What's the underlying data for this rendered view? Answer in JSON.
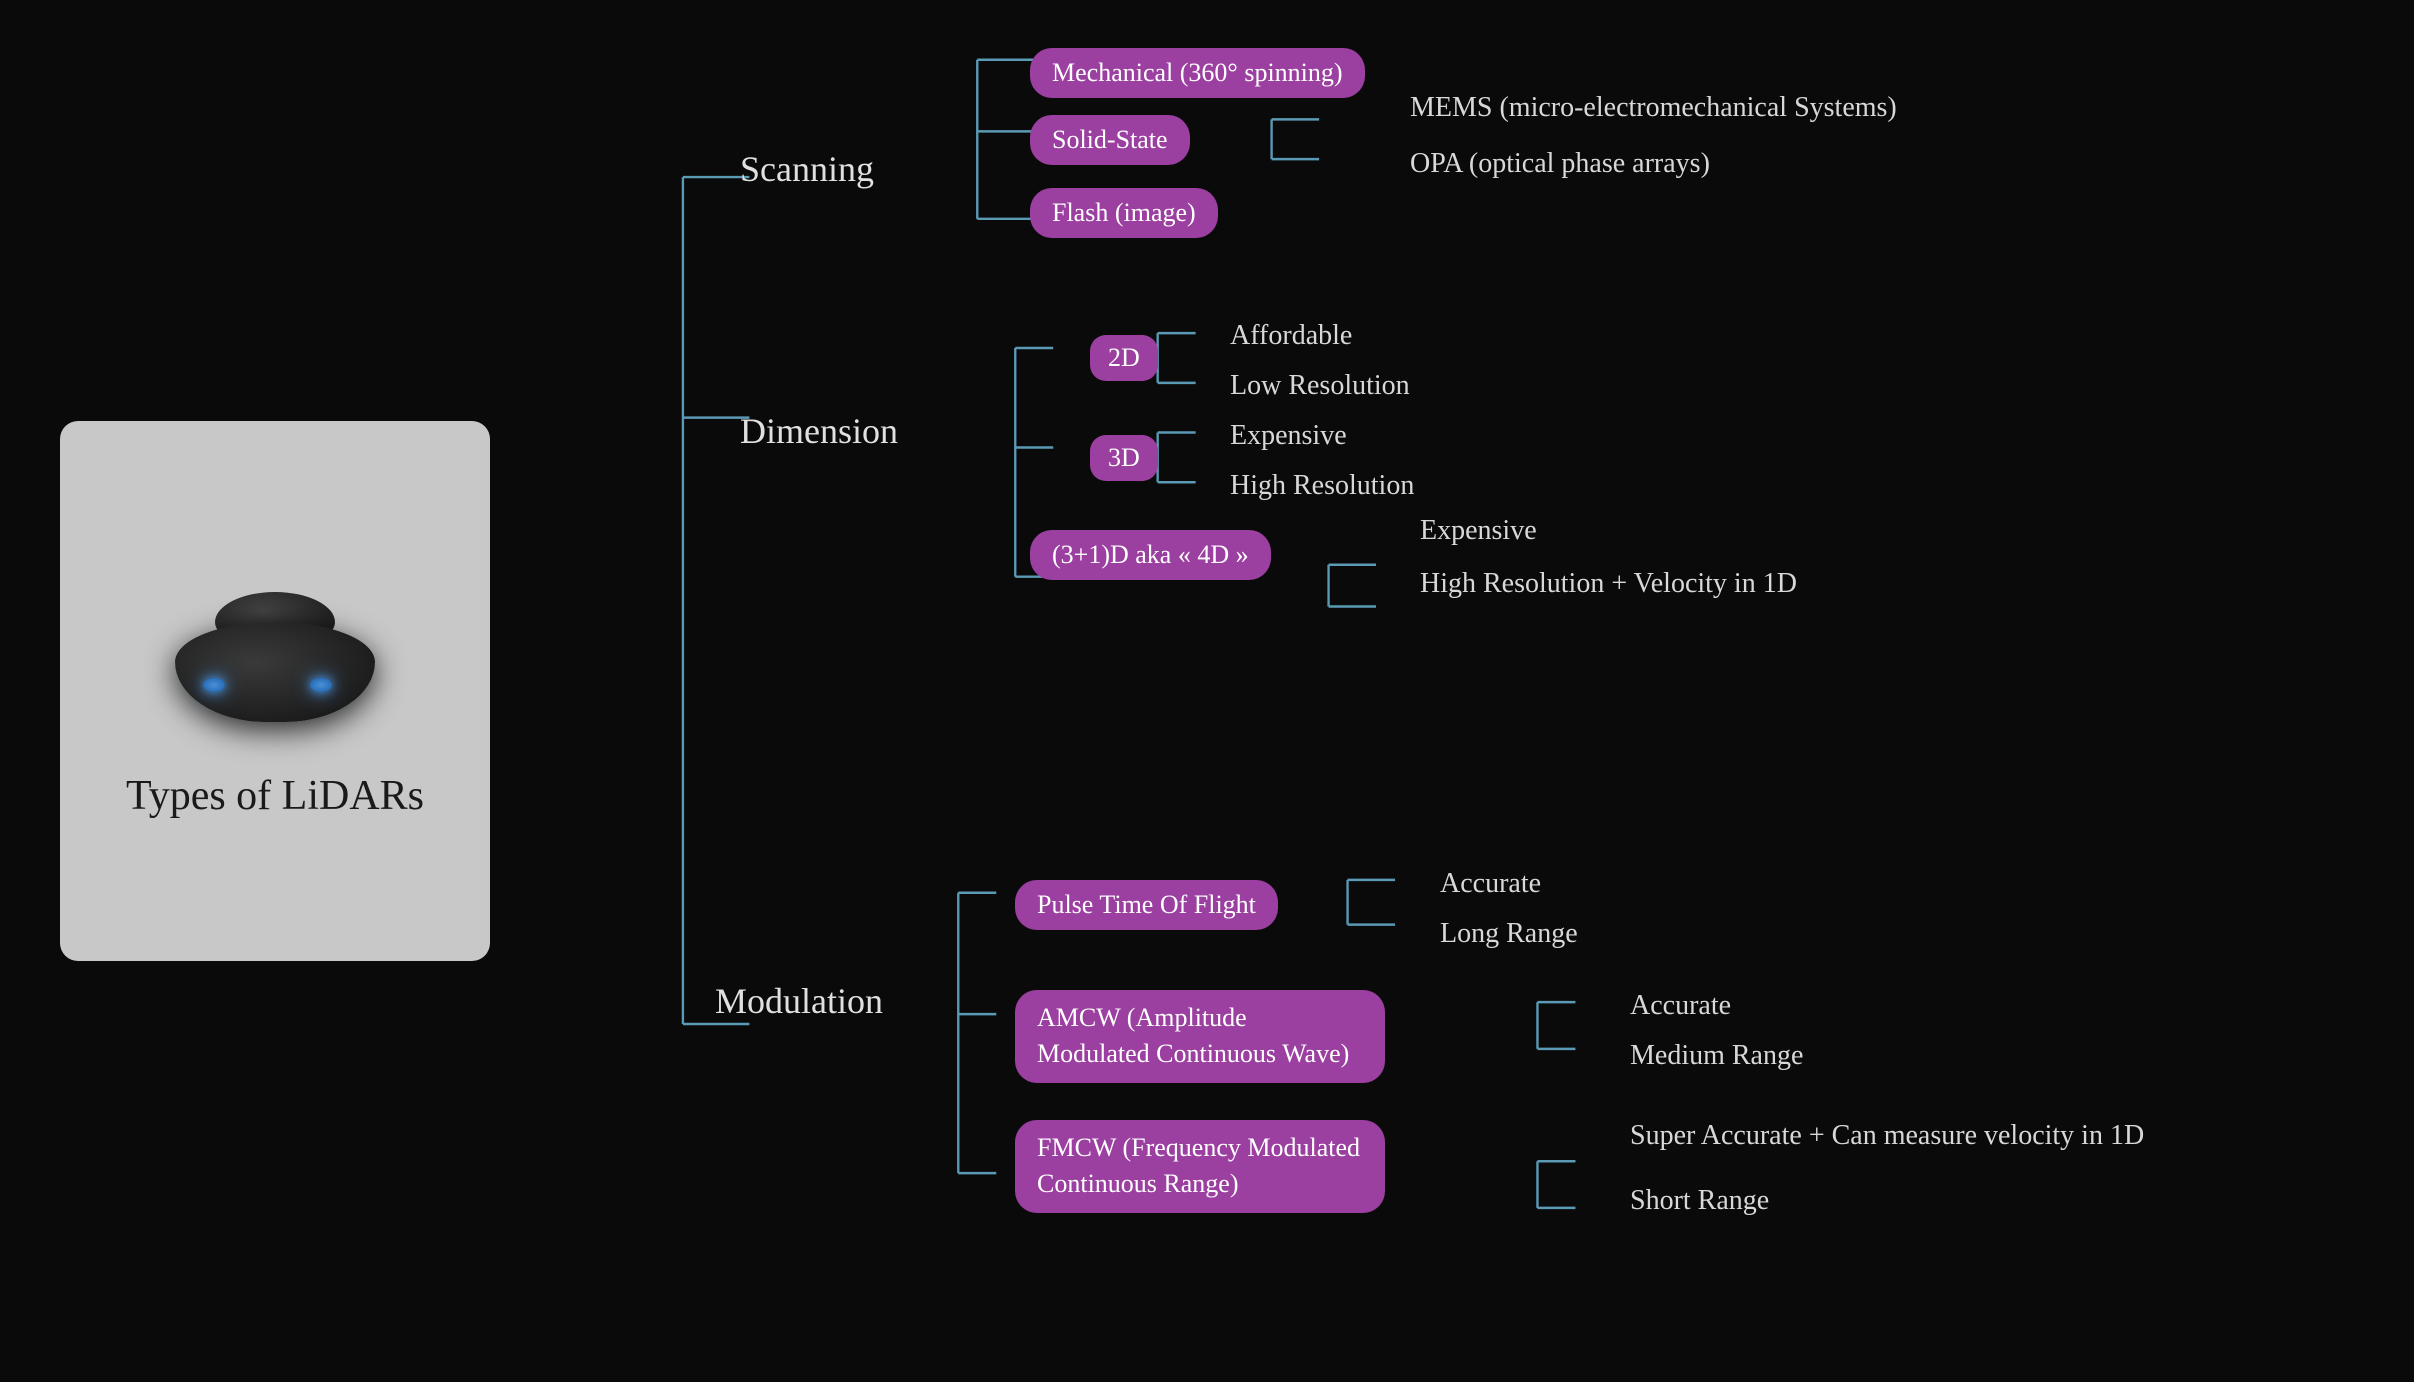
{
  "lidar": {
    "title": "Types of LiDARs"
  },
  "scanning": {
    "label": "Scanning",
    "mechanical": "Mechanical (360° spinning)",
    "solidState": "Solid-State",
    "mems": "MEMS (micro-electromechanical Systems)",
    "opa": "OPA (optical phase arrays)",
    "flash": "Flash (image)"
  },
  "dimension": {
    "label": "Dimension",
    "2d": "2D",
    "affordable": "Affordable",
    "lowRes": "Low Resolution",
    "3d": "3D",
    "expensive3d": "Expensive",
    "highRes": "High Resolution",
    "4d": "(3+1)D aka « 4D »",
    "expensive4d": "Expensive",
    "highResVel": "High Resolution + Velocity in 1D"
  },
  "modulation": {
    "label": "Modulation",
    "pulseTOF": "Pulse Time Of Flight",
    "accuratePulse": "Accurate",
    "longRange": "Long Range",
    "amcw": "AMCW (Amplitude Modulated Continuous Wave)",
    "accurateAMCW": "Accurate",
    "mediumRange": "Medium Range",
    "fmcw": "FMCW (Frequency Modulated Continuous Range)",
    "superAccurate": "Super Accurate + Can measure velocity in 1D",
    "shortRange": "Short Range"
  },
  "colors": {
    "badge": "#9b3fa0",
    "line": "#5a9ab5",
    "bg": "#0a0a0a",
    "text": "#d8d8d8"
  }
}
